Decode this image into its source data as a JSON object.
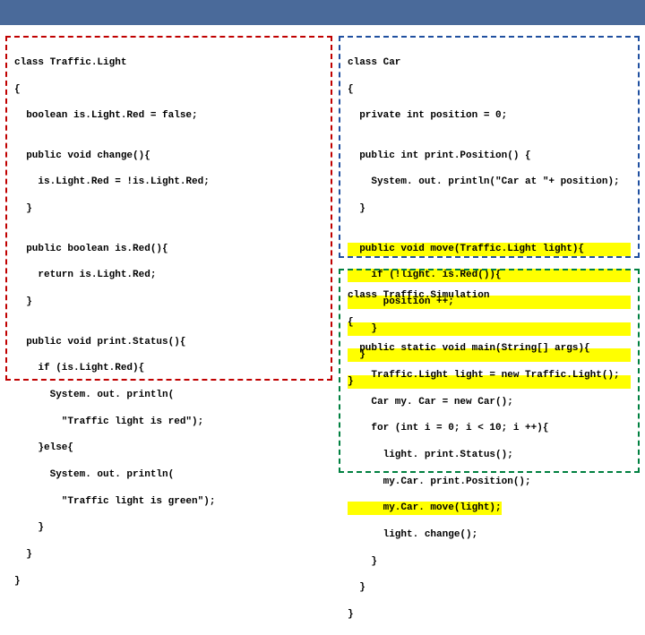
{
  "traffic_light": {
    "l1": "class Traffic.Light",
    "l2": "{",
    "l3": "  boolean is.Light.Red = false;",
    "l4": "",
    "l5": "  public void change(){",
    "l6": "    is.Light.Red = !is.Light.Red;",
    "l7": "  }",
    "l8": "",
    "l9": "  public boolean is.Red(){",
    "l10": "    return is.Light.Red;",
    "l11": "  }",
    "l12": "",
    "l13": "  public void print.Status(){",
    "l14": "    if (is.Light.Red){",
    "l15": "      System. out. println(",
    "l16": "        \"Traffic light is red\");",
    "l17": "    }else{",
    "l18": "      System. out. println(",
    "l19": "        \"Traffic light is green\");",
    "l20": "    }",
    "l21": "  }",
    "l22": "}"
  },
  "car": {
    "l1": "class Car",
    "l2": "{",
    "l3": "  private int position = 0;",
    "l4": "",
    "l5": "  public int print.Position() {",
    "l6": "    System. out. println(\"Car at \"+ position);",
    "l7": "  }",
    "l8": "",
    "h1": "  public void move(Traffic.Light light){",
    "h2": "    if (!light. is.Red()){",
    "h3": "      position ++;",
    "h4": "    }",
    "h5": "  }",
    "h6": "}"
  },
  "sim": {
    "l1": "class Traffic.Simulation",
    "l2": "{",
    "l3": "  public static void main(String[] args){",
    "l4": "    Traffic.Light light = new Traffic.Light();",
    "l5": "    Car my. Car = new Car();",
    "l6": "    for (int i = 0; i < 10; i ++){",
    "l7": "      light. print.Status();",
    "l8": "      my.Car. print.Position();",
    "h1": "      my.Car. move(light);",
    "l9": "      light. change();",
    "l10": "    }",
    "l11": "  }",
    "l12": "}"
  }
}
